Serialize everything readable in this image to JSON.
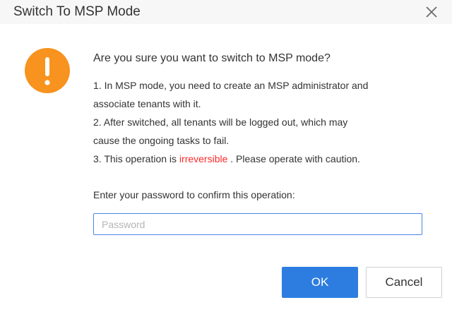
{
  "dialog": {
    "title": "Switch To MSP Mode",
    "close_icon": "close-icon",
    "warning_icon": "exclamation-icon",
    "warning_color": "#f7931e",
    "question": "Are you sure you want to switch to MSP mode?",
    "notes": {
      "line1": "1. In MSP mode, you need to create an MSP administrator and",
      "line2": "associate tenants with it.",
      "line3": "2. After switched, all tenants will be logged out, which may",
      "line4": "cause the ongoing tasks to fail.",
      "line5_prefix": "3. This operation is ",
      "line5_emphasis": "irreversible",
      "line5_suffix": " . Please operate with caution."
    },
    "emphasis_color": "#ff2a2a",
    "password": {
      "label": "Enter your password to confirm this operation:",
      "placeholder": "Password",
      "value": ""
    },
    "buttons": {
      "ok_label": "OK",
      "cancel_label": "Cancel"
    },
    "accent_color": "#2d7de0"
  }
}
